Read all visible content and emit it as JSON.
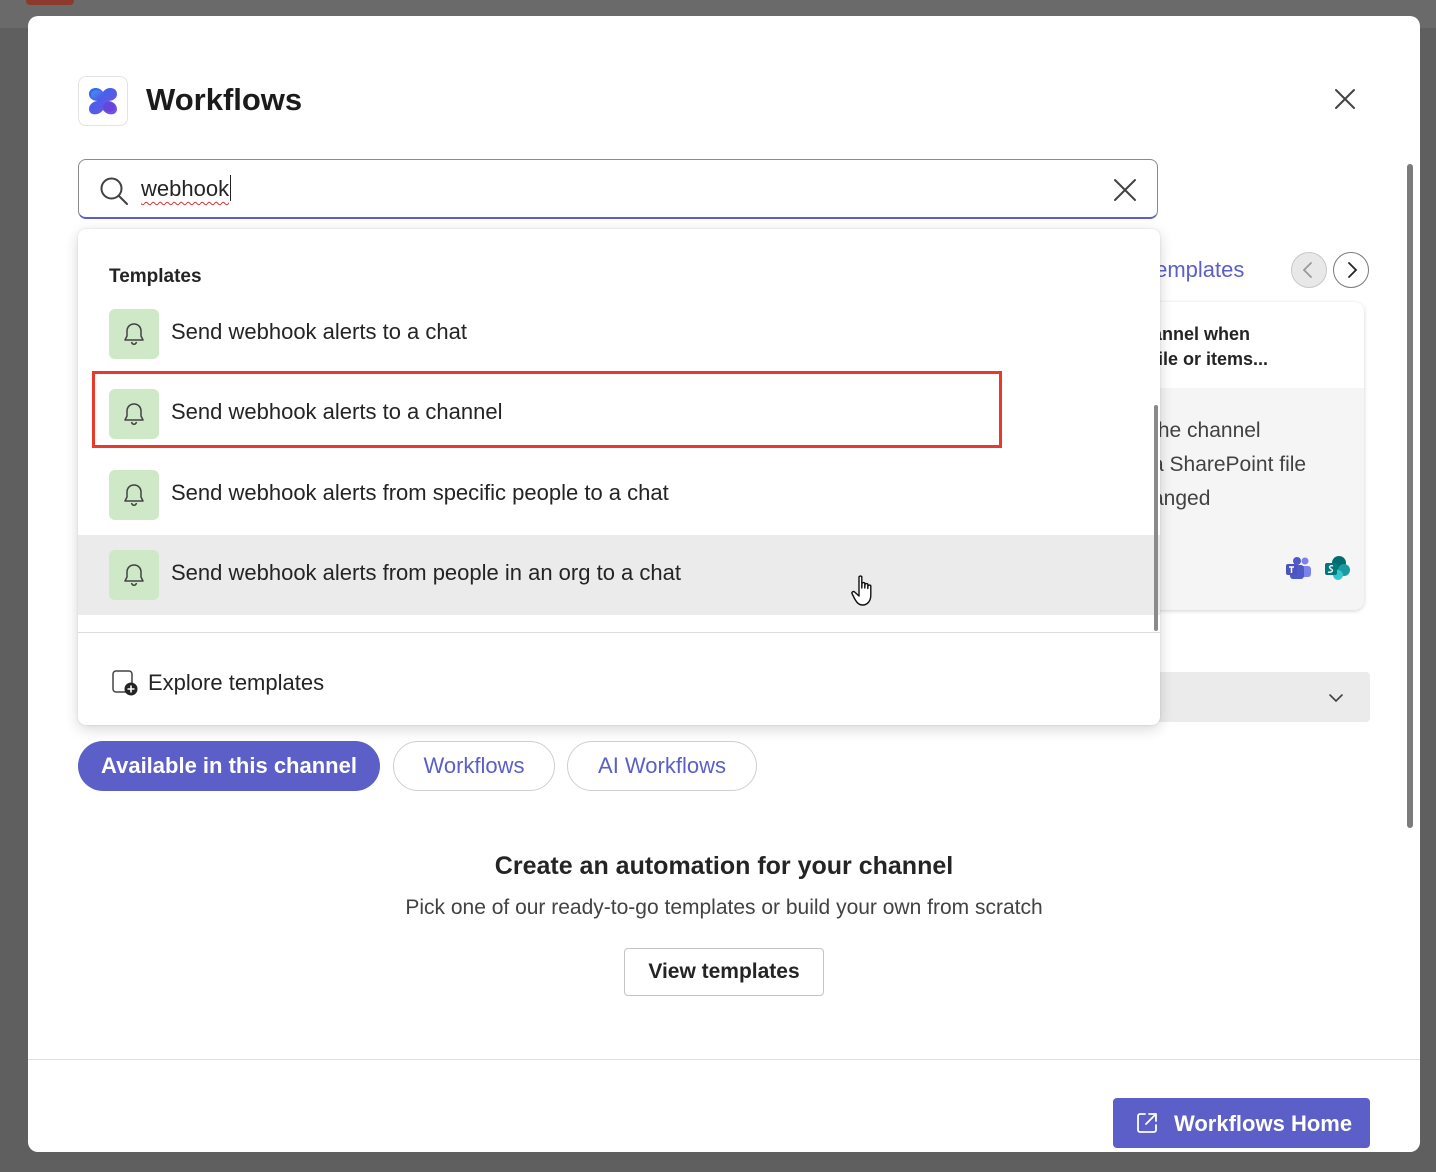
{
  "app": {
    "title": "Workflows",
    "logo_icon": "workflows-logo-icon",
    "accent_color": "#5b5fc7"
  },
  "search": {
    "value": "webhook",
    "icon": "search-icon",
    "clear_icon": "close-icon"
  },
  "dropdown": {
    "section_heading": "Templates",
    "items": [
      {
        "label": "Send webhook alerts to a chat",
        "icon": "bell-icon"
      },
      {
        "label": "Send webhook alerts to a channel",
        "icon": "bell-icon",
        "highlighted": true
      },
      {
        "label": "Send webhook alerts from specific people to a chat",
        "icon": "bell-icon"
      },
      {
        "label": "Send webhook alerts from people in an org to a chat",
        "icon": "bell-icon",
        "hovered": true
      }
    ],
    "explore_label": "Explore templates"
  },
  "background_card": {
    "view_all_label": "l templates",
    "title": "annel when\nfile or items...",
    "description": "the channel\na SharePoint file\nanged"
  },
  "tabs": [
    {
      "label": "Available in this channel",
      "active": true
    },
    {
      "label": "Workflows",
      "active": false
    },
    {
      "label": "AI Workflows",
      "active": false
    }
  ],
  "empty_state": {
    "title": "Create an automation for your channel",
    "subtitle": "Pick one of our ready-to-go templates or build your own from scratch",
    "button": "View templates"
  },
  "footer": {
    "home_button": "Workflows Home",
    "home_icon": "open-external-icon"
  }
}
